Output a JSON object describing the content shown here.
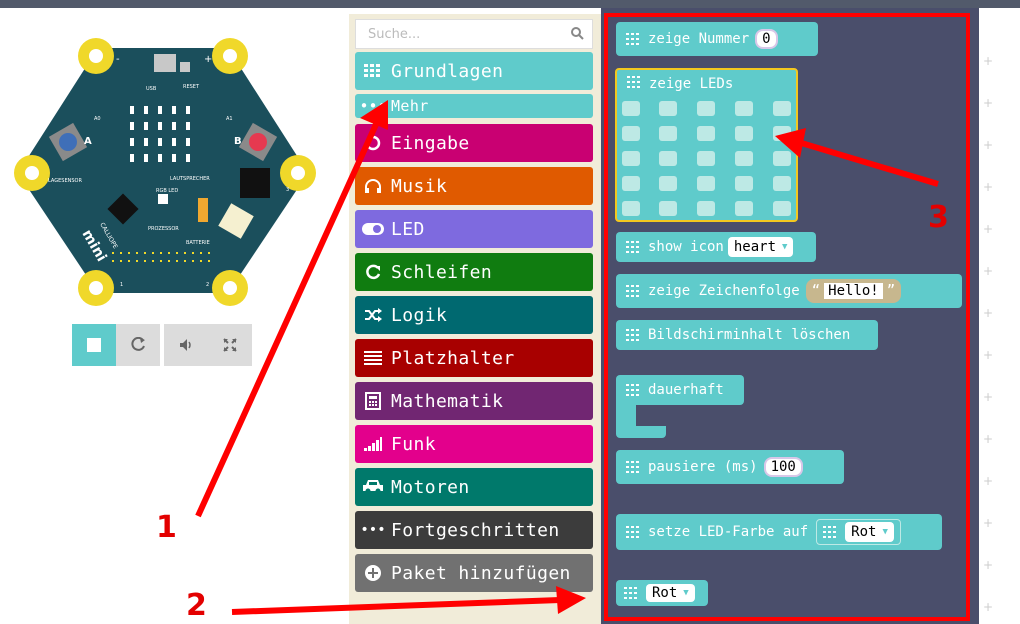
{
  "simulator": {
    "board_labels": {
      "minus": "-",
      "plus": "+",
      "usb": "USB",
      "reset": "RESET",
      "a0": "A0",
      "a1": "A1",
      "button_a": "A",
      "button_b": "B",
      "lagesensor": "LAGESENSOR",
      "lautsprecher": "LAUTSPRECHER",
      "rgb_led": "RGB LED",
      "prozessor": "PROZESSOR",
      "batterie": "BATTERIE",
      "brand": "mini",
      "brand_top": "CALLIOPE",
      "pin1": "1",
      "pin2": "2",
      "pin3": "3"
    },
    "controls": [
      {
        "name": "stop-button",
        "icon": "stop-icon"
      },
      {
        "name": "restart-button",
        "icon": "refresh-icon"
      },
      {
        "name": "mute-button",
        "icon": "speaker-icon"
      },
      {
        "name": "fullscreen-button",
        "icon": "expand-icon"
      }
    ]
  },
  "toolbox": {
    "search_placeholder": "Suche...",
    "categories": [
      {
        "label": "Grundlagen",
        "color": "#5fcbcb",
        "icon": "grid-icon"
      },
      {
        "label": "Mehr",
        "color": "#5fcbcb",
        "icon": "dots-icon"
      },
      {
        "label": "Eingabe",
        "color": "#c90072",
        "icon": "circle-icon"
      },
      {
        "label": "Musik",
        "color": "#e05a00",
        "icon": "headphones-icon"
      },
      {
        "label": "LED",
        "color": "#7e6adf",
        "icon": "toggle-icon"
      },
      {
        "label": "Schleifen",
        "color": "#107c10",
        "icon": "refresh-icon"
      },
      {
        "label": "Logik",
        "color": "#006970",
        "icon": "shuffle-icon"
      },
      {
        "label": "Platzhalter",
        "color": "#a80000",
        "icon": "list-icon"
      },
      {
        "label": "Mathematik",
        "color": "#712672",
        "icon": "calculator-icon"
      },
      {
        "label": "Funk",
        "color": "#e3008c",
        "icon": "signal-icon"
      },
      {
        "label": "Motoren",
        "color": "#00796b",
        "icon": "car-icon"
      },
      {
        "label": "Fortgeschritten",
        "color": "#3c3c3c",
        "icon": "ellipsis-icon"
      },
      {
        "label": "Paket hinzufügen",
        "color": "#717171",
        "icon": "plus-circle-icon"
      }
    ]
  },
  "workspace": {
    "blocks": {
      "zeige_nummer": {
        "label": "zeige Nummer",
        "value": "0"
      },
      "zeige_leds": {
        "label": "zeige LEDs"
      },
      "show_icon": {
        "label": "show icon",
        "value": "heart"
      },
      "zeige_zeichenfolge": {
        "label": "zeige Zeichenfolge",
        "open_quote": "“",
        "value": "Hello!",
        "close_quote": "”"
      },
      "bildschirm": {
        "label": "Bildschirminhalt löschen"
      },
      "dauerhaft": {
        "label": "dauerhaft"
      },
      "pausiere": {
        "label": "pausiere (ms)",
        "value": "100"
      },
      "setze_farbe": {
        "label": "setze LED-Farbe auf",
        "value": "Rot"
      },
      "rot": {
        "value": "Rot"
      }
    }
  },
  "annotations": {
    "n1": "1",
    "n2": "2",
    "n3": "3",
    "color": "#ff0000"
  }
}
